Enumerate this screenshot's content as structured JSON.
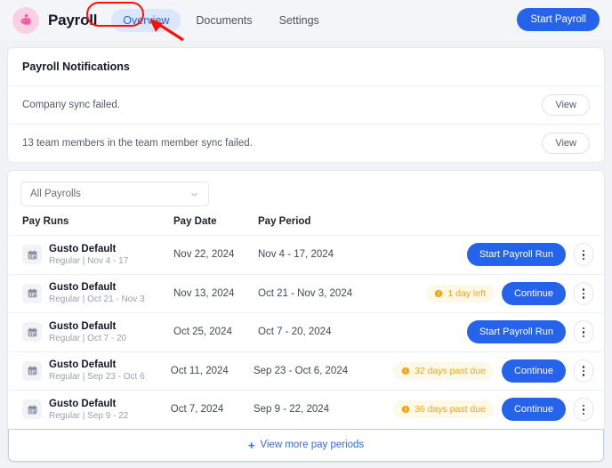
{
  "header": {
    "logo_icon": "piggy-bank-icon",
    "brand_title": "Payroll",
    "tabs": [
      {
        "label": "Overview",
        "active": true
      },
      {
        "label": "Documents",
        "active": false
      },
      {
        "label": "Settings",
        "active": false
      }
    ],
    "start_payroll_label": "Start Payroll",
    "accent_color": "#2563eb",
    "annotation_color": "#fc1100"
  },
  "notifications": {
    "title": "Payroll Notifications",
    "items": [
      {
        "text": "Company sync failed.",
        "action_label": "View"
      },
      {
        "text": "13 team members in the team member sync failed.",
        "action_label": "View"
      }
    ]
  },
  "payrolls": {
    "filter_value": "All Payrolls",
    "filter_icon": "chevron-down-icon",
    "columns": {
      "runs": "Pay Runs",
      "date": "Pay Date",
      "period": "Pay Period"
    },
    "rows": [
      {
        "icon": "calendar-icon",
        "name": "Gusto Default",
        "sub": "Regular | Nov 4 - 17",
        "pay_date": "Nov 22, 2024",
        "pay_period": "Nov 4 - 17, 2024",
        "badge": "",
        "action_label": "Start Payroll Run"
      },
      {
        "icon": "calendar-icon",
        "name": "Gusto Default",
        "sub": "Regular | Oct 21 - Nov 3",
        "pay_date": "Nov 13, 2024",
        "pay_period": "Oct 21 - Nov 3, 2024",
        "badge": "1 day left",
        "action_label": "Continue"
      },
      {
        "icon": "calendar-icon",
        "name": "Gusto Default",
        "sub": "Regular | Oct 7 - 20",
        "pay_date": "Oct 25, 2024",
        "pay_period": "Oct 7 - 20, 2024",
        "badge": "",
        "action_label": "Start Payroll Run"
      },
      {
        "icon": "calendar-icon",
        "name": "Gusto Default",
        "sub": "Regular | Sep 23 - Oct 6",
        "pay_date": "Oct 11, 2024",
        "pay_period": "Sep 23 - Oct 6, 2024",
        "badge": "32 days past due",
        "action_label": "Continue"
      },
      {
        "icon": "calendar-icon",
        "name": "Gusto Default",
        "sub": "Regular | Sep 9 - 22",
        "pay_date": "Oct 7, 2024",
        "pay_period": "Sep 9 - 22, 2024",
        "badge": "36 days past due",
        "action_label": "Continue"
      }
    ],
    "footer_label": "View more pay periods",
    "footer_icon": "plus-icon",
    "badge_color": "#f0a519",
    "badge_bg": "#fef8e7"
  }
}
